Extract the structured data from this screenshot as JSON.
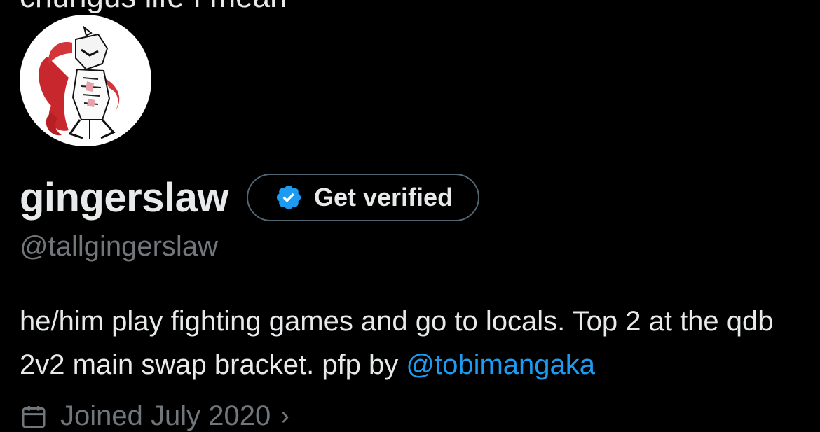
{
  "header": {
    "partial_text": "chungus life I mean"
  },
  "profile": {
    "display_name": "gingerslaw",
    "handle": "@tallgingerslaw",
    "verify_button_label": "Get verified",
    "bio_text": "he/him play fighting games and go to locals. Top 2 at the qdb 2v2 main swap bracket. pfp by ",
    "bio_mention": "@tobimangaka",
    "joined_text": "Joined July 2020",
    "joined_chevron": "›"
  },
  "icons": {
    "verified_badge": "verified-badge-icon",
    "calendar": "calendar-icon",
    "chevron": "chevron-right-icon"
  },
  "colors": {
    "background": "#000000",
    "primary_text": "#e7e9ea",
    "secondary_text": "#71767b",
    "link": "#1d9bf0",
    "verified_blue": "#1d9bf0",
    "button_border": "#536471"
  }
}
